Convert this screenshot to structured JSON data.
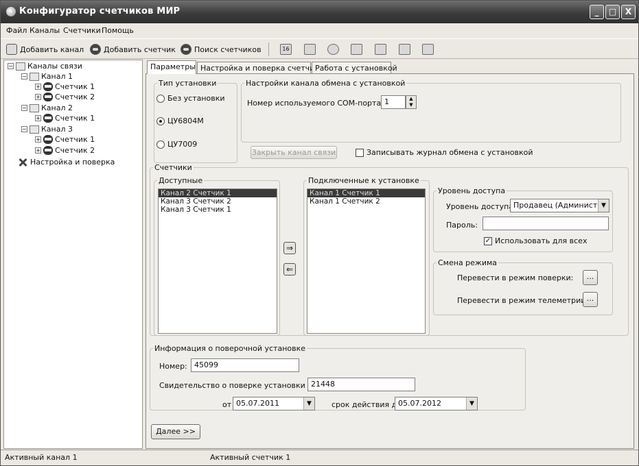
{
  "window": {
    "title": "Конфигуратор счетчиков МИР",
    "buttons": [
      "_",
      "□",
      "X"
    ]
  },
  "menu": [
    "Файл",
    "Каналы",
    "Счетчики",
    "Помощь"
  ],
  "toolbar": {
    "add_channel": "Добавить канал",
    "add_meter": "Добавить счетчик",
    "find_meters": "Поиск счетчиков",
    "calendar_icon_text": "16"
  },
  "tree": {
    "root": "Каналы связи",
    "channel1": "Канал 1",
    "channel2": "Канал 2",
    "channel3": "Канал 3",
    "meter1": "Счетчик 1",
    "meter2": "Счетчик 2",
    "setup": "Настройка и поверка",
    "expander_minus": "−",
    "expander_plus": "+"
  },
  "tabs": [
    "Параметры",
    "Настройка и поверка счетчика",
    "Работа с установкой"
  ],
  "install_type": {
    "legend": "Тип установки",
    "options": [
      "Без установки",
      "ЦУ6804М",
      "ЦУ7009"
    ],
    "selected_index": 1
  },
  "channel_settings": {
    "legend": "Настройки канала обмена с установкой",
    "com_label": "Номер используемого COM-порта:",
    "com_value": "1"
  },
  "close_channel_button": "Закрыть канал связи",
  "log_checkbox": {
    "label": "Записывать журнал обмена с установкой",
    "checked": false
  },
  "meters": {
    "legend": "Счетчики",
    "available_legend": "Доступные",
    "available": [
      "Канал 2 Счетчик 1",
      "Канал 3 Счетчик 2",
      "Канал 3 Счетчик 1"
    ],
    "connected_legend": "Подключенные к установке",
    "connected": [
      "Канал 1 Счетчик 1",
      "Канал 1 Счетчик 2"
    ]
  },
  "access": {
    "legend": "Уровень доступа",
    "level_label": "Уровень доступа:",
    "level_value": "Продавец (Администра",
    "password_label": "Пароль:",
    "password_value": "",
    "use_for_all_label": "Использовать для всех",
    "use_for_all_checked": true
  },
  "mode": {
    "legend": "Смена режима",
    "verify_label": "Перевести в режим поверки:",
    "telemetry_label": "Перевести в режим телеметрии:",
    "button_label": "..."
  },
  "verification": {
    "legend": "Информация о поверочной установке",
    "number_label": "Номер:",
    "number_value": "45099",
    "cert_label": "Свидетельство о поверке установки №:",
    "cert_value": "21448",
    "from_label": "от",
    "from_value": "05.07.2011",
    "valid_label": "срок действия до",
    "valid_value": "05.07.2012"
  },
  "next_button": "Далее >>",
  "status": {
    "channel": "Активный канал 1",
    "meter": "Активный счетчик 1"
  }
}
